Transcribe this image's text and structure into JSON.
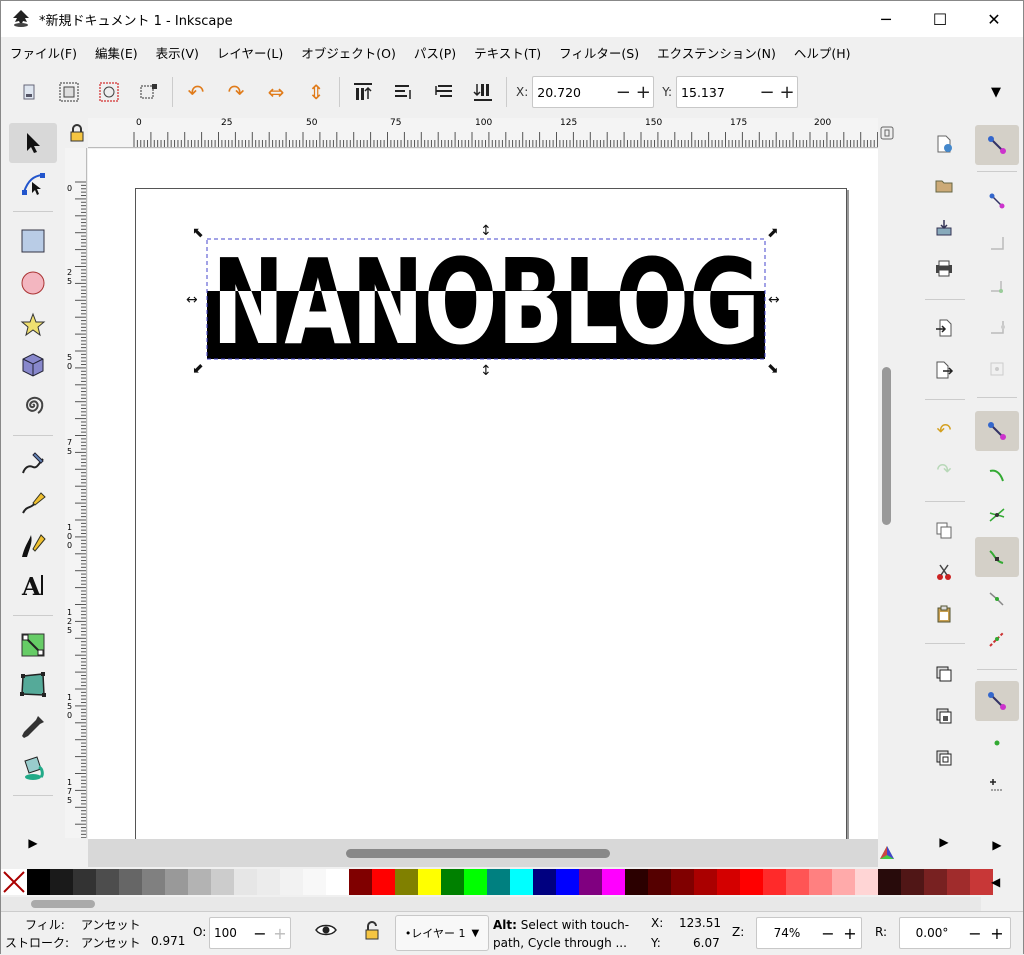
{
  "window": {
    "title": "*新規ドキュメント 1 - Inkscape",
    "minimize": "─",
    "maximize": "☐",
    "close": "✕"
  },
  "menu": [
    "ファイル(F)",
    "編集(E)",
    "表示(V)",
    "レイヤー(L)",
    "オブジェクト(O)",
    "パス(P)",
    "テキスト(T)",
    "フィルター(S)",
    "エクステンション(N)",
    "ヘルプ(H)"
  ],
  "toolbar": {
    "x_label": "X:",
    "x_value": "20.720",
    "y_label": "Y:",
    "y_value": "15.137",
    "minus": "−",
    "plus": "+",
    "overflow": "▼"
  },
  "ruler": {
    "h_labels": [
      "0",
      "25",
      "50",
      "75",
      "100",
      "125",
      "150",
      "175",
      "200"
    ],
    "v_labels": [
      "0",
      "2\n5",
      "5\n0",
      "7\n5",
      "1\n0\n0",
      "1\n2\n5",
      "1\n5\n0",
      "1\n7\n5"
    ]
  },
  "canvas": {
    "artwork_text": "NANOBLOG"
  },
  "status": {
    "fill_label": "フィル:",
    "fill_value": "アンセット",
    "stroke_label": "ストローク:",
    "stroke_value": "アンセット",
    "stroke_width": "0.971",
    "opacity_label": "O:",
    "opacity_value": "100",
    "layer": "•レイヤー 1",
    "message_bold": "Alt:",
    "message_line1": " Select with touch-",
    "message_line2": "path, Cycle through ...",
    "cursor_x_label": "X:",
    "cursor_x": "123.51",
    "cursor_y_label": "Y:",
    "cursor_y": "6.07",
    "zoom_label": "Z:",
    "zoom": "74%",
    "rotate_label": "R:",
    "rotate": "0.00°"
  },
  "palette": [
    "#000000",
    "#1a1a1a",
    "#333333",
    "#4d4d4d",
    "#666666",
    "#808080",
    "#999999",
    "#b3b3b3",
    "#cccccc",
    "#e6e6e6",
    "#ececec",
    "#f2f2f2",
    "#f8f8f8",
    "#ffffff",
    "#800000",
    "#ff0000",
    "#808000",
    "#ffff00",
    "#008000",
    "#00ff00",
    "#008080",
    "#00ffff",
    "#000080",
    "#0000ff",
    "#800080",
    "#ff00ff",
    "#2b0000",
    "#550000",
    "#800000",
    "#aa0000",
    "#d40000",
    "#ff0000",
    "#ff2a2a",
    "#ff5555",
    "#ff8080",
    "#ffaaaa",
    "#ffd5d5",
    "#280b0b",
    "#501616",
    "#782121",
    "#a02c2c",
    "#c83737"
  ]
}
